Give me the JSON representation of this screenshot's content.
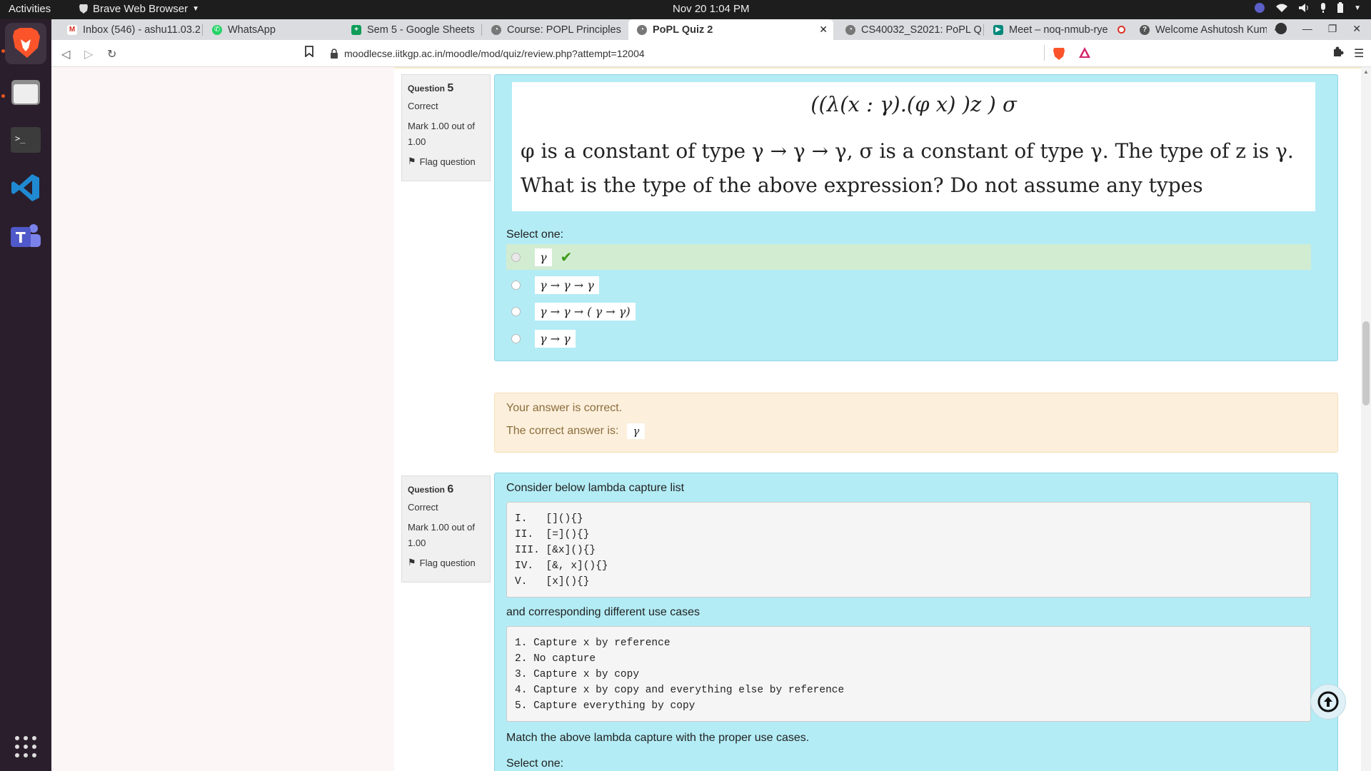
{
  "topbar": {
    "activities": "Activities",
    "app_name": "Brave Web Browser",
    "clock": "Nov 20  1:04 PM"
  },
  "tabs": [
    {
      "label": "Inbox (546) - ashu11.03.2",
      "icon": "gmail-icon",
      "color": "#d93025"
    },
    {
      "label": "WhatsApp",
      "icon": "whatsapp-icon",
      "color": "#25d366"
    },
    {
      "label": "Sem 5 - Google Sheets",
      "icon": "sheets-icon",
      "color": "#0f9d58"
    },
    {
      "label": "Course: POPL Principles",
      "icon": "moodle-icon",
      "color": "#777777"
    },
    {
      "label": "PoPL Quiz 2",
      "icon": "moodle-icon",
      "color": "#777777"
    },
    {
      "label": "CS40032_S2021: PoPL Q",
      "icon": "moodle-icon",
      "color": "#777777"
    },
    {
      "label": "Meet – noq-nmub-rye",
      "icon": "meet-icon",
      "color": "#00897b"
    },
    {
      "label": "Welcome Ashutosh Kum",
      "icon": "site-icon",
      "color": "#555555"
    }
  ],
  "address": {
    "url": "moodlecse.iitkgp.ac.in/moodle/mod/quiz/review.php?attempt=12004"
  },
  "q5": {
    "label": "Question",
    "number": "5",
    "status": "Correct",
    "mark": "Mark 1.00 out of 1.00",
    "flag": "Flag question",
    "math_expr": "((λ(x : γ).(φ x) )z ) σ",
    "math_line1": "φ is a constant of type γ → γ → γ, σ is a constant of type γ. The type of z is γ.",
    "math_line2": "What is the type of the above expression? Do not assume any types",
    "select_label": "Select one:",
    "options": [
      "γ",
      "γ → γ → γ",
      "γ → γ → ( γ → γ)",
      "γ → γ"
    ],
    "selected_index": 0,
    "feedback": "Your answer is correct.",
    "correct_label": "The correct answer is:",
    "correct_answer": "γ"
  },
  "q6": {
    "label": "Question",
    "number": "6",
    "status": "Correct",
    "mark": "Mark 1.00 out of 1.00",
    "flag": "Flag question",
    "intro": "Consider below lambda capture list",
    "captures": [
      "I.   [](){}",
      "II.  [=](){}",
      "III. [&x](){}",
      "IV.  [&, x](){}",
      "V.   [x](){}"
    ],
    "cases_intro": "and corresponding different use cases",
    "cases": [
      "1. Capture x by reference",
      "2. No capture",
      "3. Capture x by copy",
      "4. Capture x by copy and everything else by reference",
      "5. Capture everything by copy"
    ],
    "match_text": "Match the above lambda capture with the proper use cases.",
    "select_label": "Select one:"
  }
}
